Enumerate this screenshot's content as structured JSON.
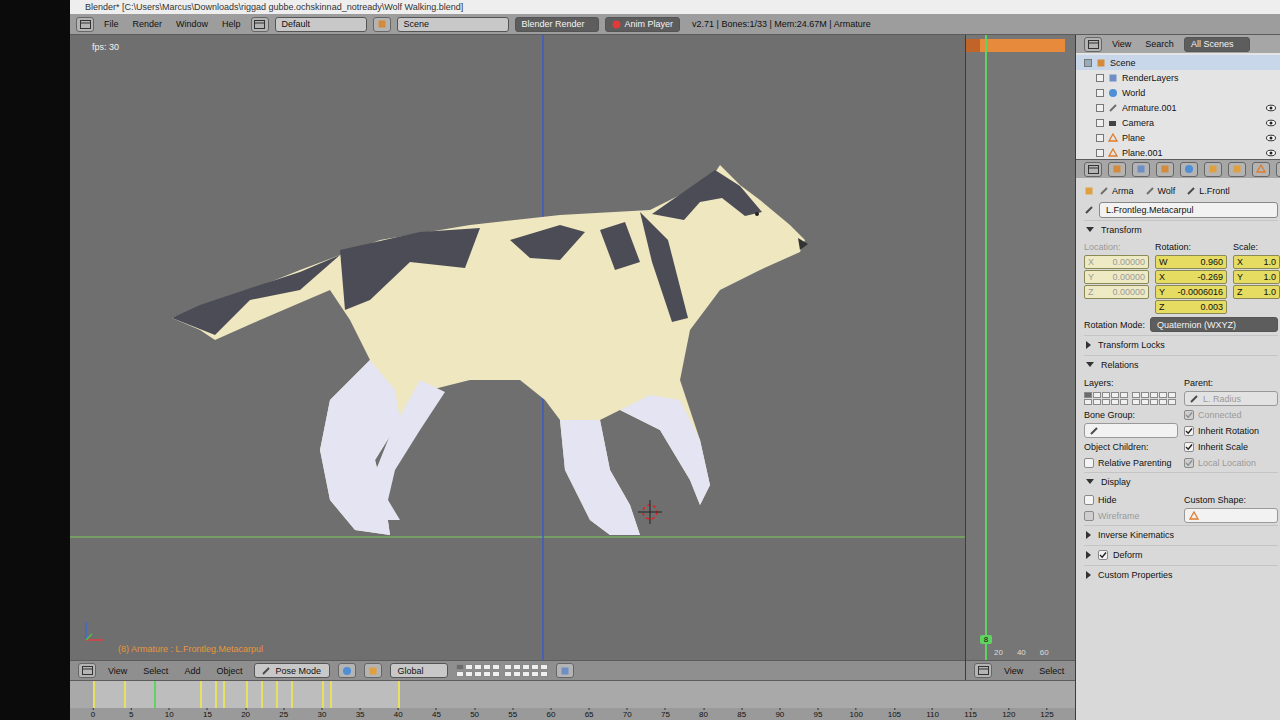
{
  "window": {
    "title": "Blender* [C:\\Users\\Marcus\\Downloads\\riggad gubbe.ochskinnad_notready\\Wolf Walking.blend]"
  },
  "info_header": {
    "menus": [
      "File",
      "Render",
      "Window",
      "Help"
    ],
    "layout": "Default",
    "scene": "Scene",
    "engine": "Blender Render",
    "anim_player": "Anim Player",
    "stats": "v2.71 | Bones:1/33 | Mem:24.67M | Armature"
  },
  "viewport": {
    "fps": "fps: 30",
    "object_info": "(8) Armature : L.Frontleg.Metacarpul"
  },
  "view_header": {
    "menus": [
      "View",
      "Select",
      "Add",
      "Object"
    ],
    "mode": "Pose Mode",
    "orientation": "Global",
    "layers": [
      {
        "on": true
      },
      {
        "on": false
      },
      {
        "on": false
      },
      {
        "on": false
      },
      {
        "on": false
      },
      {
        "on": false
      },
      {
        "on": false
      },
      {
        "on": false
      },
      {
        "on": false
      },
      {
        "on": false
      },
      {
        "on": false
      },
      {
        "on": false
      },
      {
        "on": false
      },
      {
        "on": false
      },
      {
        "on": false
      },
      {
        "on": false
      },
      {
        "on": false
      },
      {
        "on": false
      },
      {
        "on": false
      },
      {
        "on": false
      }
    ]
  },
  "mini_timeline": {
    "current_frame": "8",
    "ticks": [
      "20",
      "40",
      "60"
    ],
    "menus": [
      "View",
      "Select"
    ]
  },
  "timeline": {
    "current_frame": 8,
    "keyframes": [
      0,
      4,
      14,
      16,
      17,
      20,
      22,
      24,
      26,
      30,
      31,
      40
    ],
    "ticks": [
      "0",
      "5",
      "10",
      "15",
      "20",
      "25",
      "30",
      "35",
      "40",
      "45",
      "50",
      "55",
      "60",
      "65",
      "70",
      "75",
      "80",
      "85",
      "90",
      "95",
      "100",
      "105",
      "110",
      "115",
      "120",
      "125"
    ]
  },
  "outliner": {
    "menus": [
      "View",
      "Search"
    ],
    "filter": "All Scenes",
    "items": [
      {
        "label": "Scene",
        "depth": 0,
        "kind": "scene",
        "selected": true,
        "expanded": true
      },
      {
        "label": "RenderLayers",
        "depth": 1,
        "kind": "layers",
        "selected": false,
        "expanded": false
      },
      {
        "label": "World",
        "depth": 1,
        "kind": "world",
        "selected": false,
        "expanded": false
      },
      {
        "label": "Armature.001",
        "depth": 1,
        "kind": "armature",
        "selected": false,
        "expanded": false
      },
      {
        "label": "Camera",
        "depth": 1,
        "kind": "camera",
        "selected": false,
        "expanded": false
      },
      {
        "label": "Plane",
        "depth": 1,
        "kind": "mesh",
        "selected": false,
        "expanded": false
      },
      {
        "label": "Plane.001",
        "depth": 1,
        "kind": "mesh",
        "selected": false,
        "expanded": false
      }
    ]
  },
  "properties": {
    "tabs": [
      {
        "selected": false
      },
      {
        "selected": false
      },
      {
        "selected": false
      },
      {
        "selected": false
      },
      {
        "selected": false
      },
      {
        "selected": false
      },
      {
        "selected": false
      },
      {
        "selected": false
      },
      {
        "selected": true
      },
      {
        "selected": false
      },
      {
        "selected": false
      },
      {
        "selected": false
      }
    ],
    "breadcrumb": [
      "Arma",
      "Wolf",
      "L.Frontl"
    ],
    "bone_name": "L.Frontleg.Metacarpul",
    "transform": {
      "title": "Transform",
      "expanded": true,
      "columns": [
        {
          "label": "Location:",
          "disabled": true,
          "fields": [
            {
              "axis": "X",
              "value": "0.00000"
            },
            {
              "axis": "Y",
              "value": "0.00000"
            },
            {
              "axis": "Z",
              "value": "0.00000"
            }
          ]
        },
        {
          "label": "Rotation:",
          "disabled": false,
          "fields": [
            {
              "axis": "W",
              "value": "0.960"
            },
            {
              "axis": "X",
              "value": "-0.269"
            },
            {
              "axis": "Y",
              "value": "-0.0006016"
            },
            {
              "axis": "Z",
              "value": "0.003"
            }
          ]
        },
        {
          "label": "Scale:",
          "disabled": false,
          "fields": [
            {
              "axis": "X",
              "value": "1.0"
            },
            {
              "axis": "Y",
              "value": "1.0"
            },
            {
              "axis": "Z",
              "value": "1.0"
            }
          ]
        }
      ],
      "rotation_mode_label": "Rotation Mode:",
      "rotation_mode": "Quaternion (WXYZ)"
    },
    "transform_locks": {
      "title": "Transform Locks",
      "expanded": false
    },
    "relations": {
      "title": "Relations",
      "expanded": true,
      "layers_label": "Layers:",
      "layers": [
        {
          "on": true
        },
        {
          "on": false
        },
        {
          "on": false
        },
        {
          "on": false
        },
        {
          "on": false
        },
        {
          "on": false
        },
        {
          "on": false
        },
        {
          "on": false
        },
        {
          "on": false
        },
        {
          "on": false
        },
        {
          "on": false
        },
        {
          "on": false
        },
        {
          "on": false
        },
        {
          "on": false
        },
        {
          "on": false
        },
        {
          "on": false
        },
        {
          "on": false
        },
        {
          "on": false
        },
        {
          "on": false
        },
        {
          "on": false
        }
      ],
      "parent_label": "Parent:",
      "parent": "L. Radius",
      "parent_disabled": true,
      "options": [
        {
          "label": "Connected",
          "checked": true,
          "disabled": true
        },
        {
          "label": "Inherit Rotation",
          "checked": true,
          "disabled": false
        },
        {
          "label": "Inherit Scale",
          "checked": true,
          "disabled": false
        },
        {
          "label": "Local Location",
          "checked": true,
          "disabled": true
        }
      ],
      "bone_group_label": "Bone Group:",
      "object_children_label": "Object Children:",
      "relative_parenting": {
        "label": "Relative Parenting",
        "checked": false,
        "disabled": false
      }
    },
    "display": {
      "title": "Display",
      "expanded": true,
      "options": [
        {
          "label": "Hide",
          "checked": false,
          "disabled": false
        },
        {
          "label": "Wireframe",
          "checked": false,
          "disabled": true
        }
      ],
      "custom_shape_label": "Custom Shape:"
    },
    "collapsed_panels": [
      {
        "title": "Inverse Kinematics",
        "expanded": false,
        "kind": "plain",
        "checked": false
      },
      {
        "title": "Deform",
        "expanded": false,
        "kind": "toggle",
        "checked": true
      },
      {
        "title": "Custom Properties",
        "expanded": false,
        "kind": "plain",
        "checked": false
      }
    ]
  }
}
